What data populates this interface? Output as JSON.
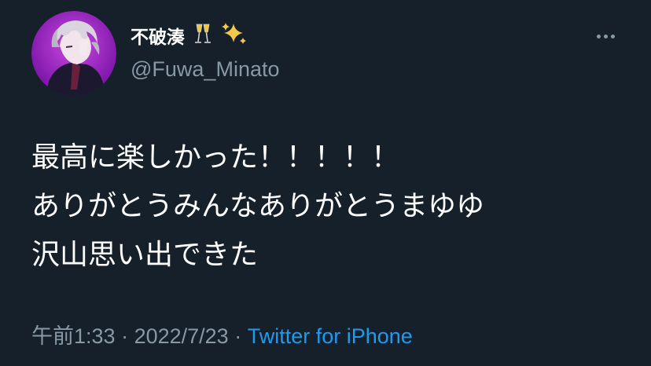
{
  "author": {
    "display_name": "不破湊",
    "handle": "@Fuwa_Minato",
    "name_emojis": [
      "champagne-glasses-icon",
      "sparkles-icon"
    ]
  },
  "tweet": {
    "lines": [
      "最高に楽しかった！！！！！",
      "ありがとうみんなありがとうまゆゆ",
      "沢山思い出できた"
    ]
  },
  "meta": {
    "time": "午前1:33",
    "separator1": " · ",
    "date": "2022/7/23",
    "separator2": " · ",
    "source": "Twitter for iPhone"
  },
  "colors": {
    "background": "#15202b",
    "primary_text": "#ffffff",
    "secondary_text": "#8899a6",
    "link": "#1d9bf0",
    "avatar_ring": "#a020c8"
  }
}
